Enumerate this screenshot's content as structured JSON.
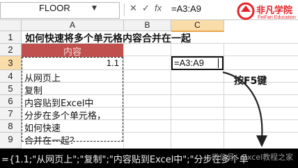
{
  "formula_bar": {
    "name_box": "FLOOR",
    "dropdown_icon": "chevron-down",
    "cancel": "✕",
    "enter": "✓",
    "fx": "fx",
    "formula": "=A3:A9"
  },
  "logo": {
    "cn": "非凡学院",
    "en": "FeiFan Education"
  },
  "columns": [
    "A",
    "B",
    "C"
  ],
  "rows": [
    "1",
    "2",
    "3",
    "4",
    "5",
    "6",
    "7",
    "8",
    "9"
  ],
  "cells": {
    "title": "如何快速将多个单元格内容合并在一起",
    "header": "内容",
    "a3": "1.1",
    "a4": "从网页上",
    "a5": "复制",
    "a6": "内容贴到Excel中",
    "a7": "分步在多个单元格，",
    "a8": "如何快速",
    "a9": "合并在一起？",
    "active": "=A3:A9"
  },
  "annotation": "按F5键",
  "result_text": "={1.1;\"从网页上\";\"复制\";\"内容贴到Excel中\";\"分步在多个单",
  "watermark": "微信号：Excel教程之家",
  "colors": {
    "header_fill": "#c0504d",
    "header_text": "#f2dcdb",
    "logo_red": "#e7212a",
    "selected_header": "#f9dca8"
  }
}
